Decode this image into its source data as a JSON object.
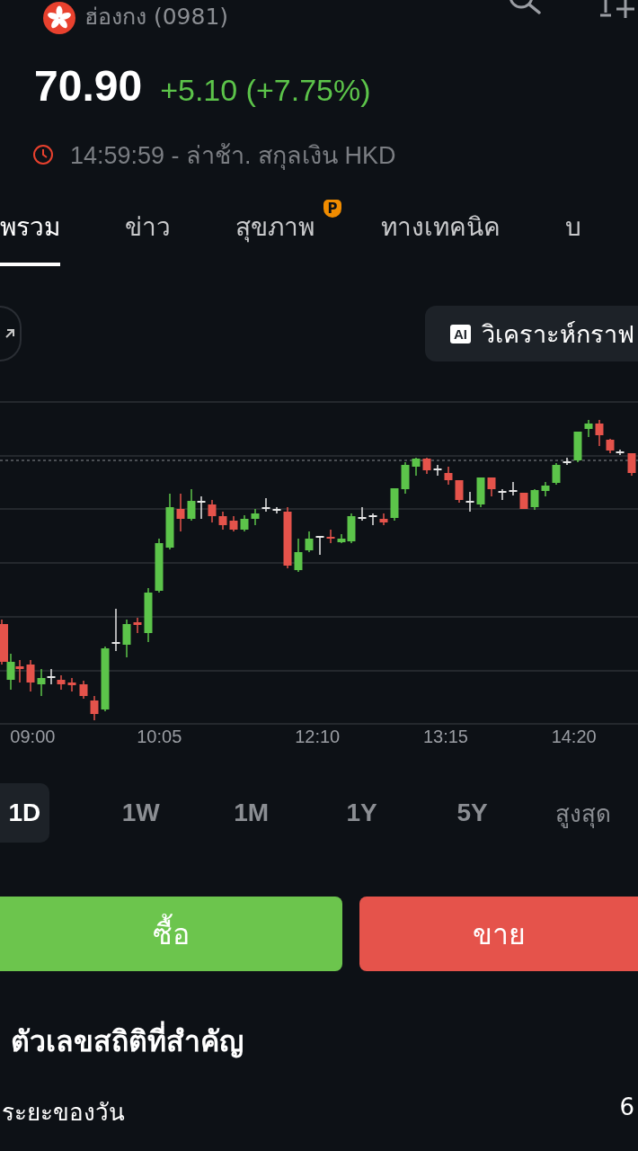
{
  "header": {
    "market_label": "ฮ่องกง (0981)",
    "price": "70.90",
    "change": "+5.10 (+7.75%)",
    "timestamp": "14:59:59 - ล่าช้า. สกุลเงิน HKD"
  },
  "tabs": [
    {
      "label": "พรวม",
      "selected": true
    },
    {
      "label": "ข่าว",
      "selected": false
    },
    {
      "label": "สุขภาพ",
      "selected": false,
      "badge": "P"
    },
    {
      "label": "ทางเทคนิค",
      "selected": false
    },
    {
      "label": "บ",
      "selected": false
    }
  ],
  "chart": {
    "ai_icon_text": "AI",
    "ai_button": "วิเคราะห์กราฟ",
    "time_labels": [
      "09:00",
      "10:05",
      "12:10",
      "13:15",
      "14:20"
    ]
  },
  "periods": [
    {
      "label": "1D",
      "selected": true
    },
    {
      "label": "1W",
      "selected": false
    },
    {
      "label": "1M",
      "selected": false
    },
    {
      "label": "1Y",
      "selected": false
    },
    {
      "label": "5Y",
      "selected": false
    },
    {
      "label": "สูงสุด",
      "selected": false
    }
  ],
  "actions": [
    {
      "label": "ซื้อ",
      "kind": "buy"
    },
    {
      "label": "ขาย",
      "kind": "sell"
    }
  ],
  "stats": {
    "title": "ตัวเลขสถิติที่สำคัญ",
    "rows": [
      {
        "label": "ระยะของวัน",
        "value": "6"
      }
    ]
  }
}
